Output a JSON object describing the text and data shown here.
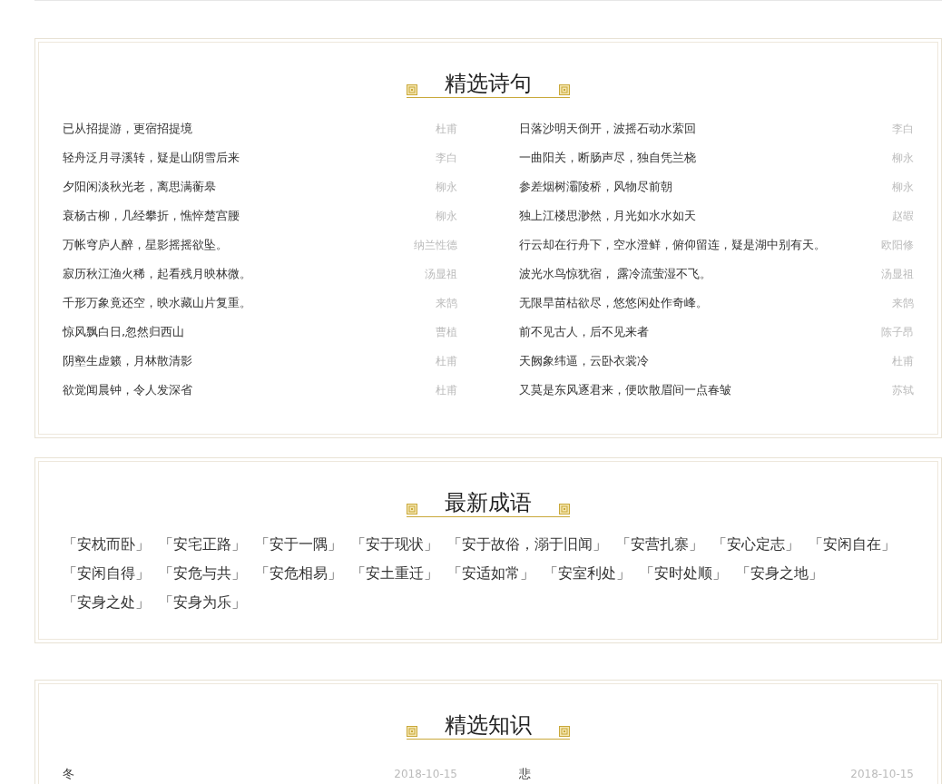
{
  "poems": {
    "title": "精选诗句",
    "items": [
      {
        "text": "已从招提游，更宿招提境",
        "author": "杜甫"
      },
      {
        "text": "日落沙明天倒开，波摇石动水萦回",
        "author": "李白"
      },
      {
        "text": "轻舟泛月寻溪转，疑是山阴雪后来",
        "author": "李白"
      },
      {
        "text": "一曲阳关，断肠声尽，独自凭兰桡",
        "author": "柳永"
      },
      {
        "text": "夕阳闲淡秋光老，离思满蘅皋",
        "author": "柳永"
      },
      {
        "text": "参差烟树灞陵桥，风物尽前朝",
        "author": "柳永"
      },
      {
        "text": "衰杨古柳，几经攀折，憔悴楚宫腰",
        "author": "柳永"
      },
      {
        "text": "独上江楼思渺然，月光如水水如天",
        "author": "赵嘏"
      },
      {
        "text": "万帐穹庐人醉，星影摇摇欲坠。",
        "author": "纳兰性德"
      },
      {
        "text": "行云却在行舟下，空水澄鲜，俯仰留连，疑是湖中别有天。",
        "author": "欧阳修"
      },
      {
        "text": "寂历秋江渔火稀，起看残月映林微。",
        "author": "汤显祖"
      },
      {
        "text": "波光水鸟惊犹宿， 露冷流萤湿不飞。",
        "author": "汤显祖"
      },
      {
        "text": "千形万象竟还空，映水藏山片复重。",
        "author": "来鹄"
      },
      {
        "text": "无限旱苗枯欲尽，悠悠闲处作奇峰。",
        "author": "来鹄"
      },
      {
        "text": "惊风飘白日,忽然归西山",
        "author": "曹植"
      },
      {
        "text": "前不见古人，后不见来者",
        "author": "陈子昂"
      },
      {
        "text": "阴壑生虚籁，月林散清影",
        "author": "杜甫"
      },
      {
        "text": "天阙象纬逼，云卧衣裳冷",
        "author": "杜甫"
      },
      {
        "text": "欲觉闻晨钟，令人发深省",
        "author": "杜甫"
      },
      {
        "text": "又莫是东风逐君来，便吹散眉间一点春皱",
        "author": "苏轼"
      }
    ]
  },
  "idioms": {
    "title": "最新成语",
    "items": [
      "「安枕而卧」",
      "「安宅正路」",
      "「安于一隅」",
      "「安于现状」",
      "「安于故俗，溺于旧闻」",
      "「安营扎寨」",
      "「安心定志」",
      "「安闲自在」",
      "「安闲自得」",
      "「安危与共」",
      "「安危相易」",
      "「安土重迁」",
      "「安适如常」",
      "「安室利处」",
      "「安时处顺」",
      "「安身之地」",
      "「安身之处」",
      "「安身为乐」"
    ]
  },
  "knowledge": {
    "title": "精选知识",
    "items": [
      {
        "text": "冬",
        "date": "2018-10-15"
      },
      {
        "text": "悲",
        "date": "2018-10-15"
      }
    ]
  }
}
